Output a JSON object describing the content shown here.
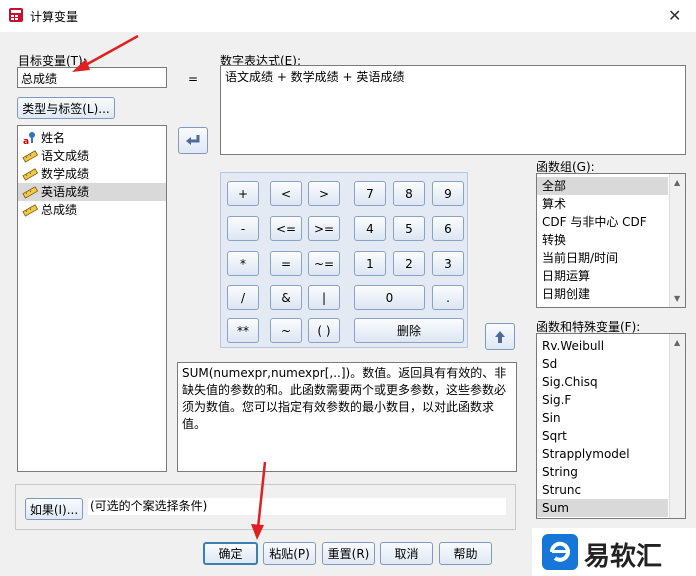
{
  "window": {
    "title": "计算变量",
    "close_glyph": "✕"
  },
  "target": {
    "label": "目标变量(T):",
    "value": "总成绩",
    "type_label_button": "类型与标签(L)..."
  },
  "equals": "=",
  "expression": {
    "label": "数字表达式(E):",
    "value": "语文成绩 + 数学成绩 + 英语成绩"
  },
  "variables": [
    {
      "name": "姓名",
      "icon": "string-variable-icon",
      "selected": false
    },
    {
      "name": "语文成绩",
      "icon": "scale-variable-icon",
      "selected": false
    },
    {
      "name": "数学成绩",
      "icon": "scale-variable-icon",
      "selected": false
    },
    {
      "name": "英语成绩",
      "icon": "scale-variable-icon",
      "selected": true
    },
    {
      "name": "总成绩",
      "icon": "scale-variable-icon",
      "selected": false
    }
  ],
  "keypad": {
    "ops": [
      "+",
      "<",
      ">",
      "-",
      "<=",
      ">=",
      "*",
      "=",
      "~=",
      "/",
      "&",
      "|",
      "**",
      "~",
      "( )"
    ],
    "digits": [
      "7",
      "8",
      "9",
      "4",
      "5",
      "6",
      "1",
      "2",
      "3"
    ],
    "zero": "0",
    "dot": ".",
    "delete": "删除"
  },
  "function_desc": "SUM(numexpr,numexpr[,..])。数值。返回具有有效的、非缺失值的参数的和。此函数需要两个或更多参数，这些参数必须为数值。您可以指定有效参数的最小数目，以对此函数求值。",
  "function_groups": {
    "label": "函数组(G):",
    "items": [
      "全部",
      "算术",
      "CDF 与非中心 CDF",
      "转换",
      "当前日期/时间",
      "日期运算",
      "日期创建"
    ],
    "selected": 0
  },
  "functions": {
    "label": "函数和特殊变量(F):",
    "items": [
      "Rv.Weibull",
      "Sd",
      "Sig.Chisq",
      "Sig.F",
      "Sin",
      "Sqrt",
      "Strapplymodel",
      "String",
      "Strunc",
      "Sum"
    ],
    "selected": 9
  },
  "if_button": "如果(I)...",
  "if_condition": "(可选的个案选择条件)",
  "buttons": {
    "ok": "确定",
    "paste": "粘贴(P)",
    "reset": "重置(R)",
    "cancel": "取消",
    "help": "帮助"
  },
  "watermark": "易软汇",
  "colors": {
    "selection": "#d9d9d9",
    "accent": "#7e9ac0",
    "arrow": "#e02020",
    "brand": "#1677d9"
  }
}
